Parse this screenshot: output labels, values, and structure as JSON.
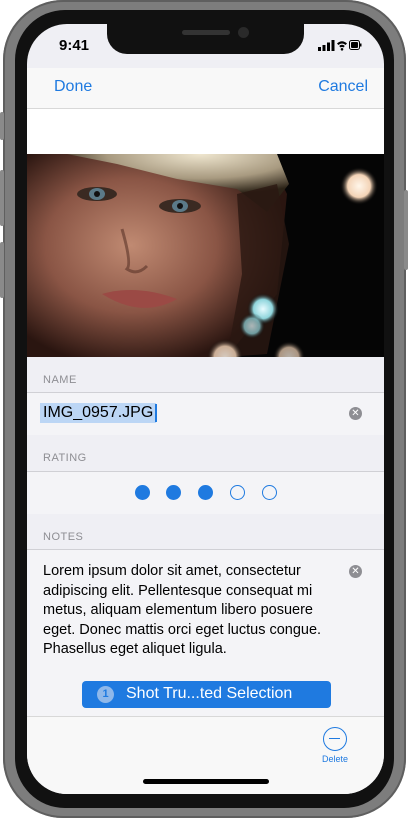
{
  "status_bar": {
    "time": "9:41"
  },
  "nav": {
    "done_label": "Done",
    "cancel_label": "Cancel"
  },
  "form": {
    "name": {
      "header": "NAME",
      "value": "IMG_0957.JPG"
    },
    "rating": {
      "header": "RATING",
      "value": 3,
      "max": 5
    },
    "notes": {
      "header": "NOTES",
      "text": "Lorem ipsum dolor sit amet, consectetur adipiscing elit. Pellentesque consequat mi metus, aliquam elementum libero posuere eget. Donec mattis orci eget luctus congue. Phasellus eget aliquet ligula."
    }
  },
  "suggestion": {
    "badge": "1",
    "label": "Shot Tru...ted Selection"
  },
  "toolbar": {
    "delete_label": "Delete"
  },
  "colors": {
    "accent": "#1f7ae0",
    "background": "#efeff4"
  }
}
